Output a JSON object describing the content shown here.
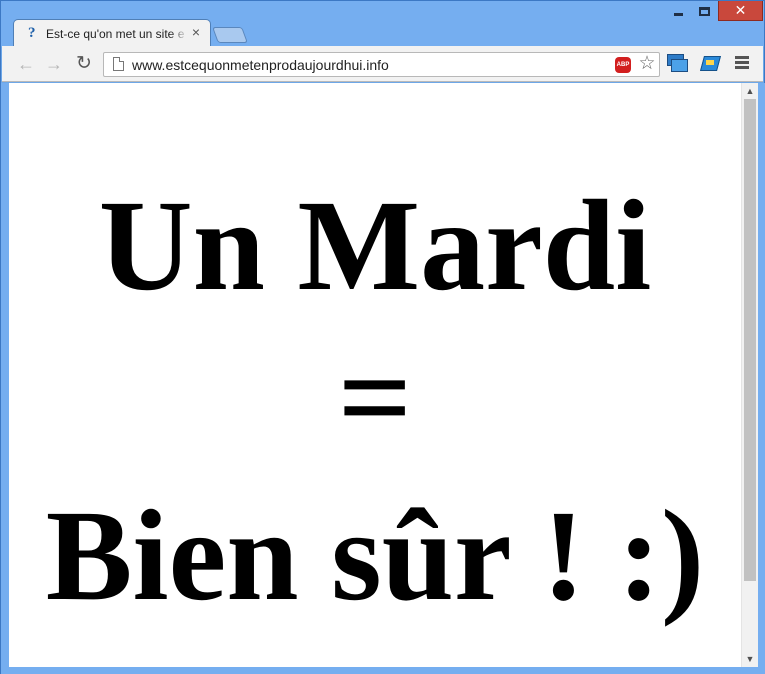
{
  "browser": {
    "tab": {
      "favicon": "?",
      "title": "Est-ce qu'on met un site e",
      "close": "×"
    },
    "window_controls": {
      "close": "✕"
    },
    "nav": {
      "back": "←",
      "forward": "→",
      "reload": "↻"
    },
    "omnibox": {
      "url": "www.estcequonmetenprodaujourdhui.info"
    },
    "extensions": {
      "abp_label": "ABP",
      "star": "☆"
    },
    "scrollbar": {
      "up": "▲",
      "down": "▼"
    }
  },
  "page": {
    "line_1": "Un Mardi",
    "line_2": "=",
    "line_3": "Bien sûr ! :)"
  },
  "colors": {
    "frame": "#75aef0",
    "window_close": "#c9483c",
    "abp_red": "#d21f1f"
  }
}
